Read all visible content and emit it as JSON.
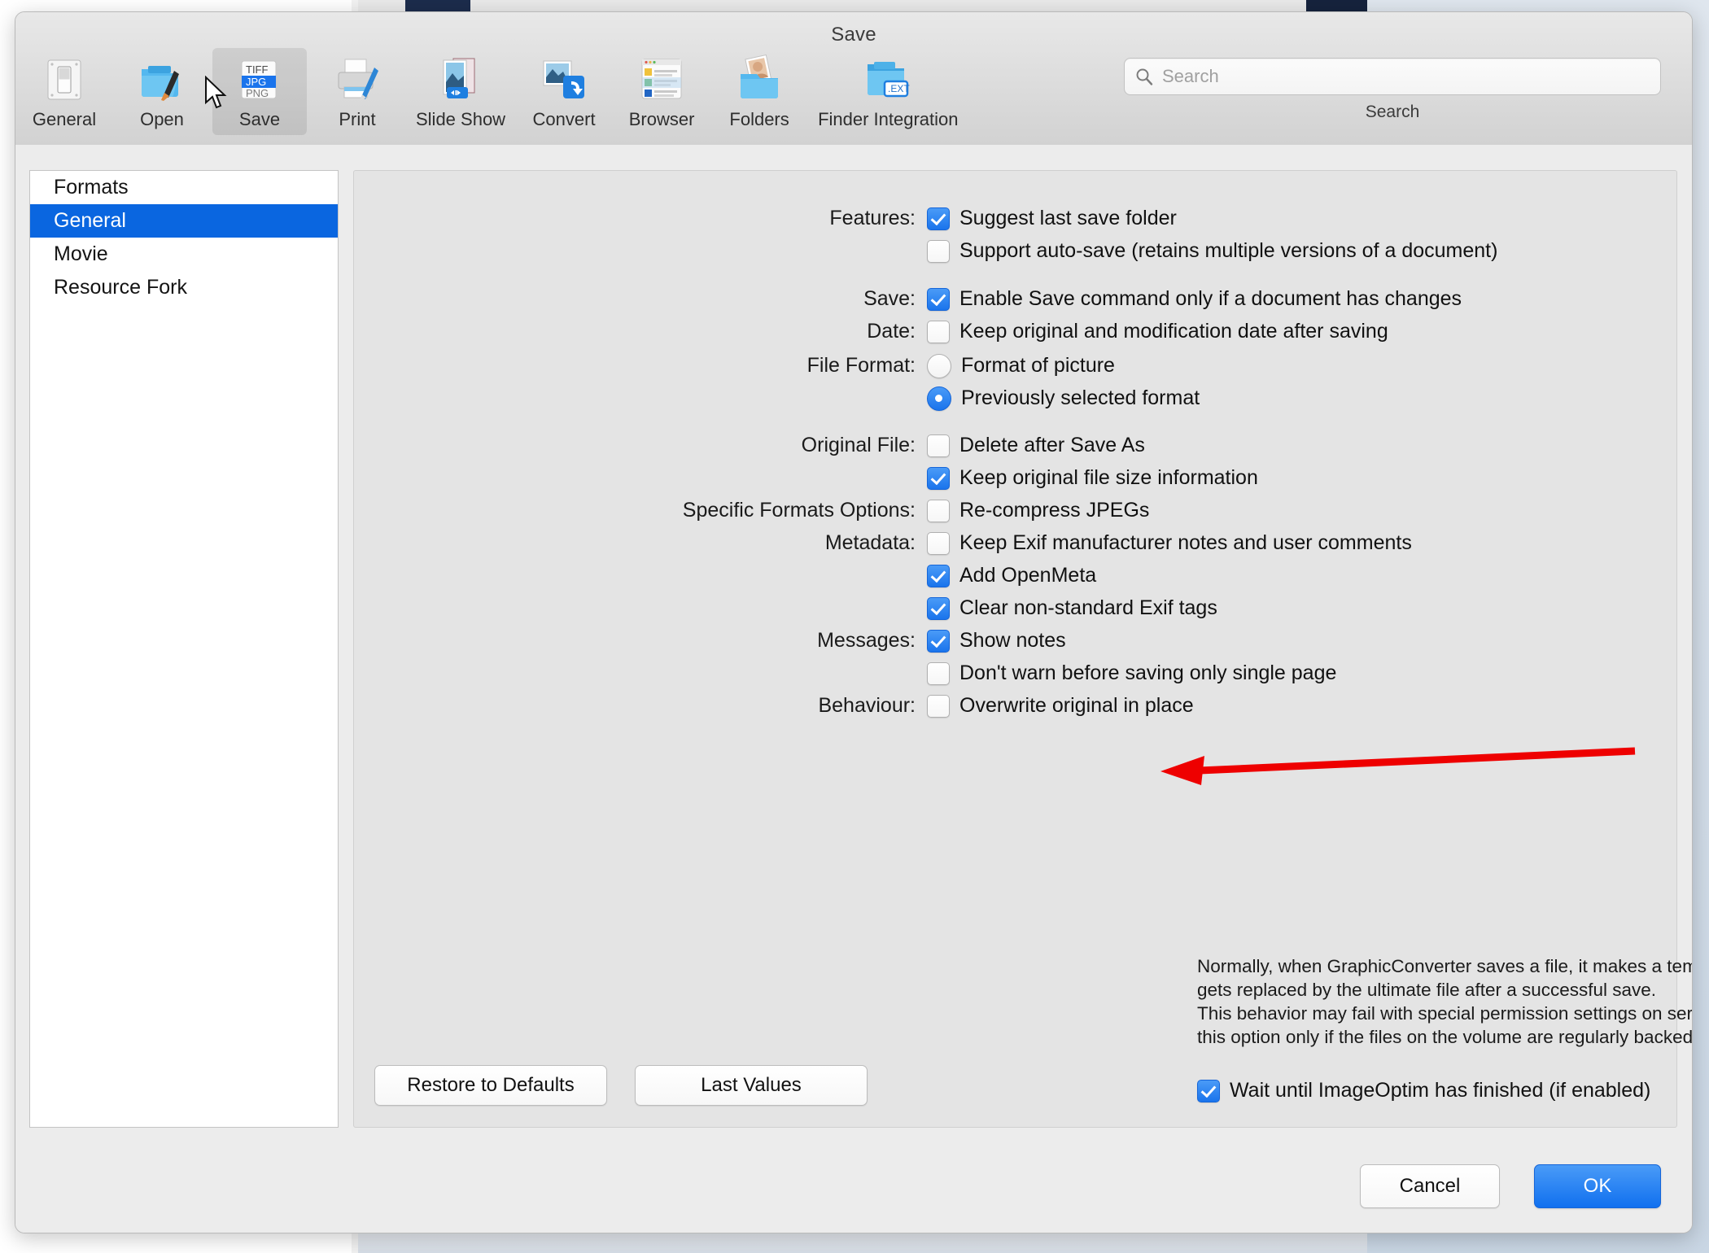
{
  "window": {
    "title": "Save"
  },
  "toolbar": {
    "items": [
      {
        "label": "General",
        "icon": "switch-panel-icon",
        "selected": false
      },
      {
        "label": "Open",
        "icon": "folder-brush-icon",
        "selected": false
      },
      {
        "label": "Save",
        "icon": "file-formats-icon",
        "selected": true
      },
      {
        "label": "Print",
        "icon": "printer-icon",
        "selected": false
      },
      {
        "label": "Slide Show",
        "icon": "slideshow-icon",
        "selected": false
      },
      {
        "label": "Convert",
        "icon": "convert-icon",
        "selected": false
      },
      {
        "label": "Browser",
        "icon": "browser-icon",
        "selected": false
      },
      {
        "label": "Folders",
        "icon": "folders-photo-icon",
        "selected": false
      },
      {
        "label": "Finder Integration",
        "icon": "finder-ext-icon",
        "selected": false
      }
    ],
    "format_badges": [
      "TIFF",
      "JPG",
      "PNG"
    ],
    "ext_badge": ".EXT"
  },
  "search": {
    "placeholder": "Search",
    "value": "",
    "caption": "Search",
    "icon": "search-icon"
  },
  "sidebar": {
    "items": [
      {
        "label": "Formats",
        "selected": false
      },
      {
        "label": "General",
        "selected": true
      },
      {
        "label": "Movie",
        "selected": false
      },
      {
        "label": "Resource Fork",
        "selected": false
      }
    ]
  },
  "settings": {
    "groups": [
      {
        "label": "Features:",
        "rows": [
          {
            "type": "checkbox",
            "checked": true,
            "text": "Suggest last save folder"
          },
          {
            "type": "checkbox",
            "checked": false,
            "text": "Support auto-save (retains multiple versions of a document)"
          }
        ]
      },
      {
        "label": "Save:",
        "rows": [
          {
            "type": "checkbox",
            "checked": true,
            "text": "Enable Save command only if a document has changes"
          }
        ]
      },
      {
        "label": "Date:",
        "rows": [
          {
            "type": "checkbox",
            "checked": false,
            "text": "Keep original and modification date after saving"
          }
        ]
      },
      {
        "label": "File Format:",
        "rows": [
          {
            "type": "radio",
            "checked": false,
            "text": "Format of picture"
          },
          {
            "type": "radio",
            "checked": true,
            "text": "Previously selected format"
          }
        ]
      },
      {
        "label": "Original File:",
        "rows": [
          {
            "type": "checkbox",
            "checked": false,
            "text": "Delete after Save As"
          },
          {
            "type": "checkbox",
            "checked": true,
            "text": "Keep original file size information"
          }
        ]
      },
      {
        "label": "Specific Formats Options:",
        "rows": [
          {
            "type": "checkbox",
            "checked": false,
            "text": "Re-compress JPEGs"
          }
        ]
      },
      {
        "label": "Metadata:",
        "rows": [
          {
            "type": "checkbox",
            "checked": false,
            "text": "Keep Exif manufacturer notes and user comments"
          },
          {
            "type": "checkbox",
            "checked": true,
            "text": "Add OpenMeta"
          },
          {
            "type": "checkbox",
            "checked": true,
            "text": "Clear non-standard Exif tags"
          }
        ]
      },
      {
        "label": "Messages:",
        "rows": [
          {
            "type": "checkbox",
            "checked": true,
            "text": "Show notes"
          },
          {
            "type": "checkbox",
            "checked": false,
            "text": "Don't warn before saving only single page"
          }
        ]
      },
      {
        "label": "Behaviour:",
        "rows": [
          {
            "type": "checkbox",
            "checked": false,
            "text": "Overwrite original in place"
          }
        ]
      }
    ],
    "note_lines": [
      "Normally, when GraphicConverter saves a file, it makes a temporary file first, which then",
      "gets replaced by the ultimate file after a successful save.",
      "This behavior may fail with special permission settings on server volumes. Please enable",
      "this option only if the files on the volume are regularly backed up."
    ],
    "image_optim": {
      "checked": true,
      "text": "Wait until ImageOptim has finished (if enabled)"
    }
  },
  "buttons": {
    "restore_defaults": "Restore to Defaults",
    "last_values": "Last Values",
    "cancel": "Cancel",
    "ok": "OK"
  },
  "annotation": {
    "type": "red-arrow",
    "points_to": "Overwrite original in place"
  },
  "colors": {
    "accent": "#0a66e0",
    "checkbox_on": "#1a74ec",
    "annotation_red": "#ee0000",
    "window_bg": "#ececec",
    "pane_bg": "#e4e4e4"
  }
}
